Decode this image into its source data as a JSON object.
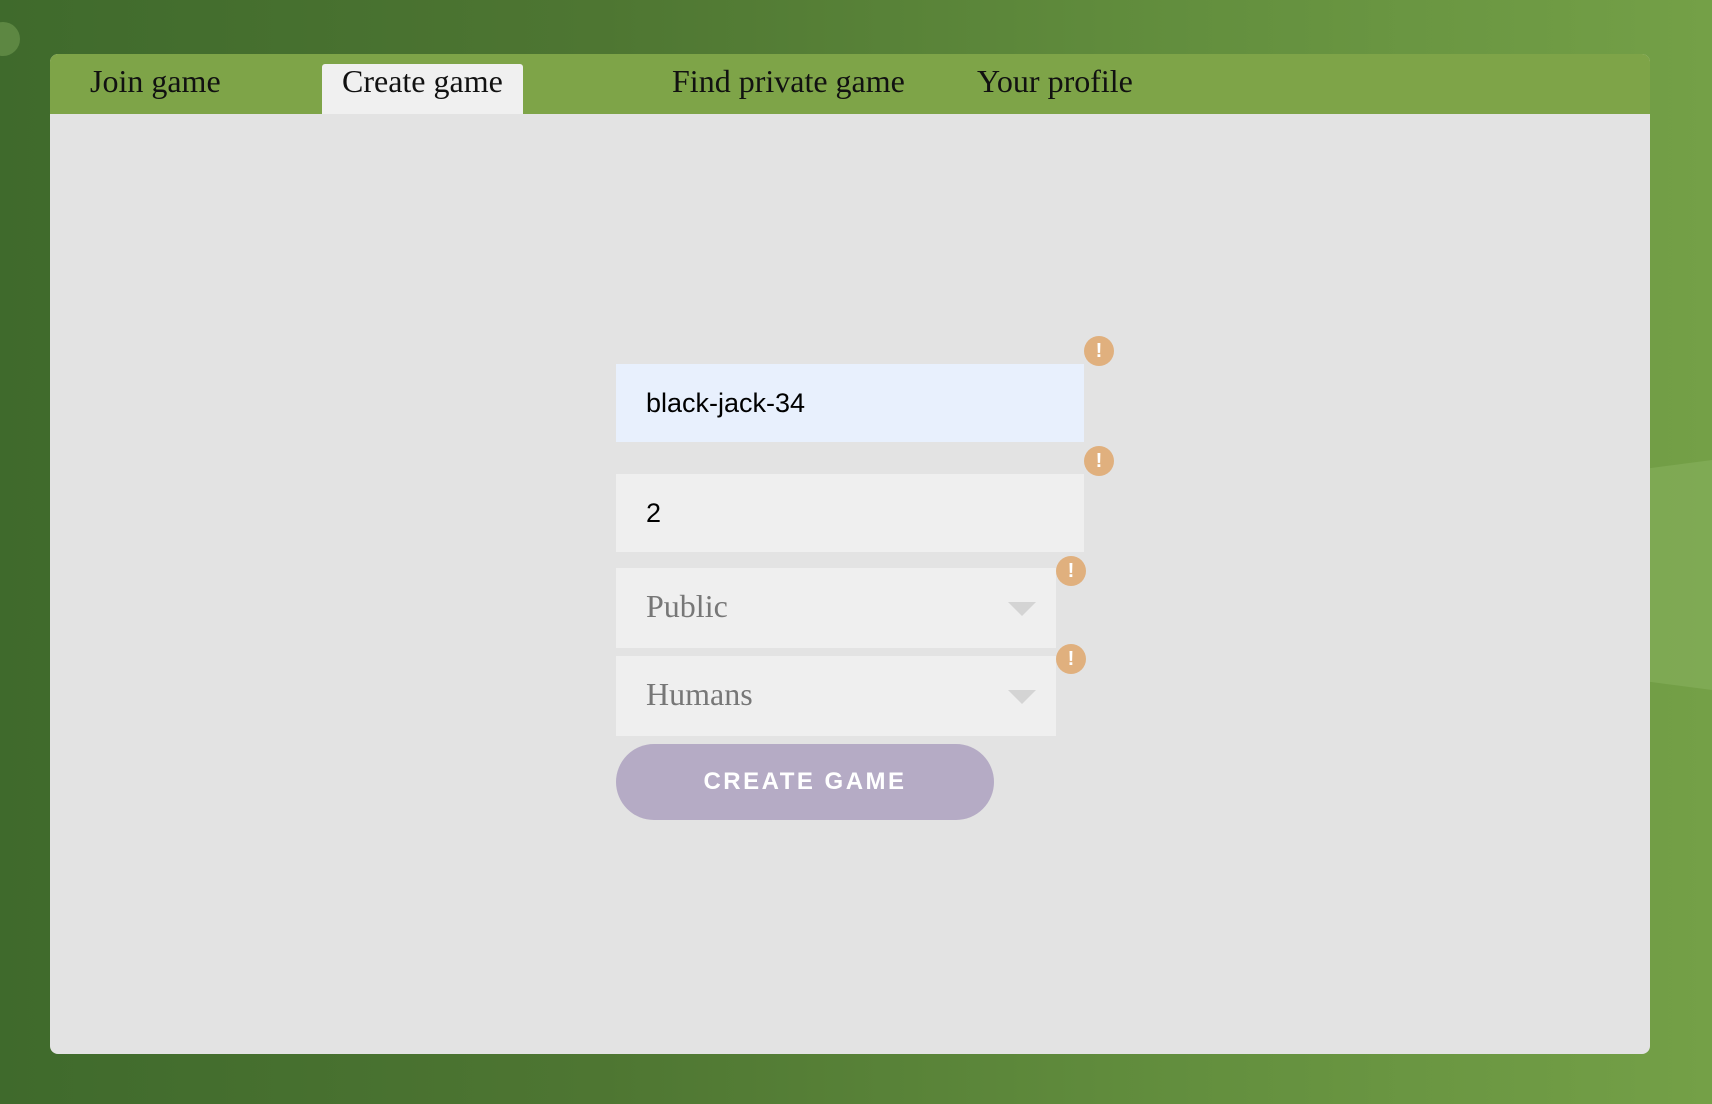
{
  "tabs": [
    {
      "label": "Join game",
      "active": false
    },
    {
      "label": "Create game",
      "active": true
    },
    {
      "label": "Find private game",
      "active": false
    },
    {
      "label": "Your profile",
      "active": false
    }
  ],
  "form": {
    "game_name": {
      "value": "black-jack-34"
    },
    "players": {
      "value": "2"
    },
    "visibility": {
      "selected": "Public"
    },
    "opponents": {
      "selected": "Humans"
    },
    "warning_glyph": "!",
    "submit_label": "CREATE GAME"
  },
  "colors": {
    "tab_bar": "#7ea448",
    "panel": "#e3e3e3",
    "warning": "#e0b07e",
    "button": "#b5abc5",
    "autofill": "#e8f0fd"
  },
  "icons": {
    "warning": "exclamation-circle-icon",
    "dropdown": "caret-down-icon"
  }
}
